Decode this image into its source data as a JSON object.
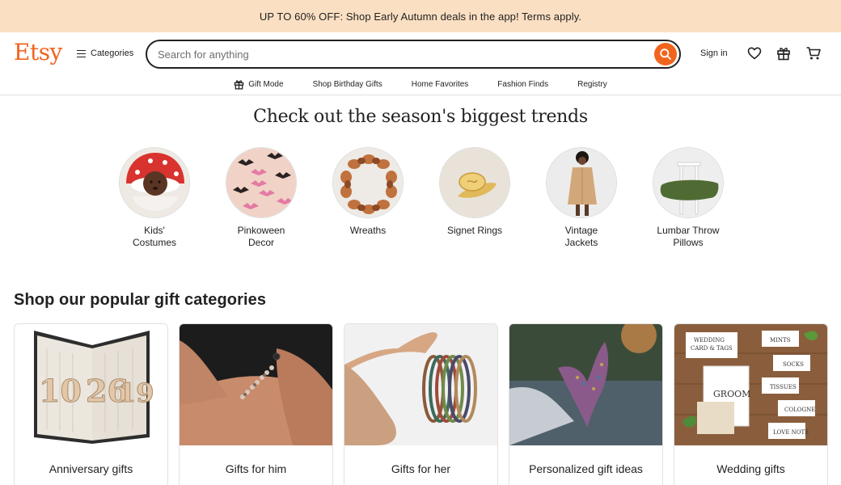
{
  "promo": {
    "text": "UP TO 60% OFF: Shop Early Autumn deals in the app! Terms apply."
  },
  "header": {
    "logo": "Etsy",
    "categories_label": "Categories",
    "search_placeholder": "Search for anything",
    "signin_label": "Sign in"
  },
  "subnav": [
    {
      "label": "Gift Mode",
      "icon": "gift-icon"
    },
    {
      "label": "Shop Birthday Gifts"
    },
    {
      "label": "Home Favorites"
    },
    {
      "label": "Fashion Finds"
    },
    {
      "label": "Registry"
    }
  ],
  "trends": {
    "title": "Check out the season's biggest trends",
    "items": [
      {
        "line1": "Kids'",
        "line2": "Costumes"
      },
      {
        "line1": "Pinkoween",
        "line2": "Decor"
      },
      {
        "line1": "Wreaths",
        "line2": ""
      },
      {
        "line1": "Signet Rings",
        "line2": ""
      },
      {
        "line1": "Vintage",
        "line2": "Jackets"
      },
      {
        "line1": "Lumbar Throw",
        "line2": "Pillows"
      }
    ]
  },
  "gifts": {
    "title": "Shop our popular gift categories",
    "cards": [
      {
        "label": "Anniversary gifts"
      },
      {
        "label": "Gifts for him"
      },
      {
        "label": "Gifts for her"
      },
      {
        "label": "Personalized gift ideas"
      },
      {
        "label": "Wedding gifts"
      }
    ]
  },
  "colors": {
    "brand": "#f1641e",
    "promo_bg": "#fbdfc2"
  }
}
